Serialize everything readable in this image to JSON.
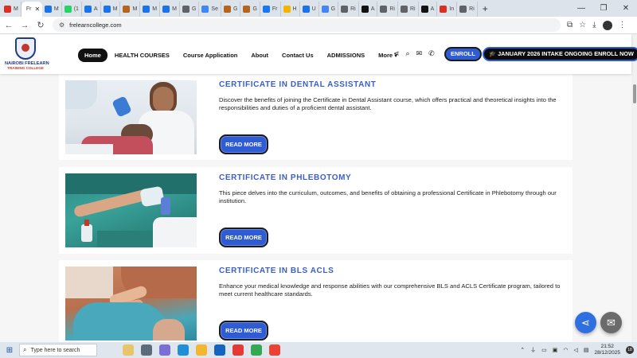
{
  "browser": {
    "tabs": [
      {
        "label": "M",
        "color": "#d93025"
      },
      {
        "label": "Fr",
        "color": "#2f5bd3",
        "active": true
      },
      {
        "label": "M",
        "color": "#1a73e8"
      },
      {
        "label": "(1",
        "color": "#25d366"
      },
      {
        "label": "A",
        "color": "#1a73e8"
      },
      {
        "label": "M",
        "color": "#1a73e8"
      },
      {
        "label": "M",
        "color": "#b5651d"
      },
      {
        "label": "M",
        "color": "#1a73e8"
      },
      {
        "label": "M",
        "color": "#1a73e8"
      },
      {
        "label": "G",
        "color": "#5f6368"
      },
      {
        "label": "Se",
        "color": "#4285f4"
      },
      {
        "label": "G",
        "color": "#b5651d"
      },
      {
        "label": "G",
        "color": "#b5651d"
      },
      {
        "label": "Fr",
        "color": "#1877f2"
      },
      {
        "label": "H",
        "color": "#f4b400"
      },
      {
        "label": "U",
        "color": "#1a73e8"
      },
      {
        "label": "G",
        "color": "#4285f4"
      },
      {
        "label": "Ri",
        "color": "#5f6368"
      },
      {
        "label": "A",
        "color": "#111111"
      },
      {
        "label": "Ri",
        "color": "#5f6368"
      },
      {
        "label": "Ri",
        "color": "#5f6368"
      },
      {
        "label": "A",
        "color": "#111111"
      },
      {
        "label": "In",
        "color": "#d93025"
      },
      {
        "label": "Ri",
        "color": "#5f6368"
      }
    ],
    "new_tab": "+",
    "url": "frelearncollege.com"
  },
  "site": {
    "logo_line1": "NAIROBI FRELEARN",
    "logo_line2": "TRAINING COLLEGE",
    "nav": {
      "home": "Home",
      "health_courses": "HEALTH COURSES",
      "course_application": "Course Application",
      "about": "About",
      "contact": "Contact Us",
      "admissions": "ADMISSIONS",
      "more": "More"
    },
    "enroll": "ENROLL",
    "intake": "JANUARY 2026 INTAKE ONGOING ENROLL NOW"
  },
  "courses": [
    {
      "title": "CERTIFICATE IN DENTAL ASSISTANT",
      "description": "Discover the benefits of joining the Certificate in Dental Assistant course, which offers practical and theoretical insights into the responsibilities and duties of a proficient dental assistant.",
      "button": "READ MORE"
    },
    {
      "title": "CERTIFICATE IN PHLEBOTOMY",
      "description": "This piece delves into the curriculum, outcomes, and benefits of obtaining a professional Certificate in Phlebotomy through our institution.",
      "button": "READ MORE"
    },
    {
      "title": "CERTIFICATE IN BLS ACLS",
      "description": "Enhance your medical knowledge and response abilities with our comprehensive BLS and ACLS Certificate program, tailored to meet current healthcare standards.",
      "button": "READ MORE"
    }
  ],
  "taskbar": {
    "search_placeholder": "Type here to search",
    "time": "21:52",
    "date": "28/12/2025",
    "notifications": "18"
  }
}
